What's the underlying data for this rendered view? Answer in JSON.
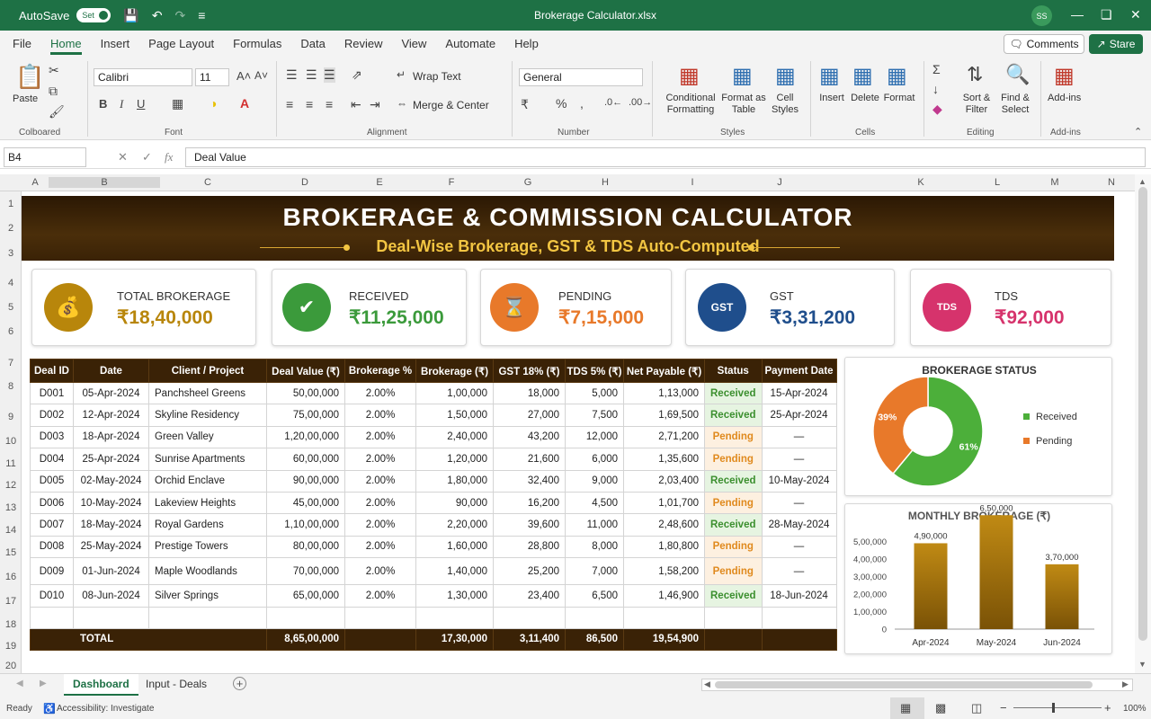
{
  "titlebar": {
    "autosave": "AutoSave",
    "toggle": "Set",
    "filename": "Brokerage Calculator.xlsx",
    "user_initials": "SS"
  },
  "menu": {
    "items": [
      "File",
      "Home",
      "Insert",
      "Page Layout",
      "Formulas",
      "Data",
      "Review",
      "View",
      "Automate",
      "Help"
    ],
    "comments": "Comments",
    "share": "Stare"
  },
  "ribbon": {
    "paste": "Paste",
    "font_name": "Calibri",
    "font_size": "11",
    "wrap_text": "Wrap Text",
    "merge_center": "Merge & Center",
    "number_format": "General",
    "conditional": "Conditional Formatting",
    "format_table": "Format as Table",
    "cell_styles": "Cell Styles",
    "insert": "Insert",
    "delete": "Delete",
    "format": "Format",
    "sort_filter": "Sort & Filter",
    "find_select": "Find & Select",
    "addins": "Add-ins",
    "groups": {
      "clipboard": "Colboared",
      "font": "Font",
      "alignment": "Alignment",
      "number": "Number",
      "styles": "Styles",
      "cells": "Cells",
      "editing": "Editing",
      "addins": "Add-ins"
    }
  },
  "formula_bar": {
    "name_box": "B4",
    "fx": "fx",
    "content": "Deal Value"
  },
  "columns": [
    "A",
    "B",
    "C",
    "D",
    "E",
    "F",
    "G",
    "H",
    "I",
    "J",
    "K",
    "L",
    "M",
    "N"
  ],
  "rows": [
    "1",
    "2",
    "3",
    "4",
    "5",
    "6",
    "7",
    "8",
    "9",
    "10",
    "11",
    "12",
    "13",
    "14",
    "15",
    "16",
    "17",
    "18",
    "19",
    "20"
  ],
  "banner": {
    "title": "BROKERAGE & COMMISSION CALCULATOR",
    "subtitle": "Deal-Wise Brokerage, GST & TDS Auto-Computed"
  },
  "kpis": [
    {
      "label": "TOTAL BROKERAGE",
      "value": "₹18,40,000",
      "color": "#b8860b",
      "icon": "money-hand-icon"
    },
    {
      "label": "RECEIVED",
      "value": "₹11,25,000",
      "color": "#3b9a3b",
      "icon": "handshake-icon"
    },
    {
      "label": "PENDING",
      "value": "₹7,15,000",
      "color": "#e8792a",
      "icon": "hourglass-icon"
    },
    {
      "label": "GST",
      "value": "₹3,31,200",
      "color": "#1f4e8c",
      "icon": "gst-icon"
    },
    {
      "label": "TDS",
      "value": "₹92,000",
      "color": "#d6336c",
      "icon": "tds-icon"
    }
  ],
  "table": {
    "headers": [
      "Deal ID",
      "Date",
      "Client / Project",
      "Deal Value (₹)",
      "Brokerage %",
      "Brokerage (₹)",
      "GST 18% (₹)",
      "TDS 5% (₹)",
      "Net Payable (₹)",
      "Status",
      "Payment Date"
    ],
    "rows": [
      [
        "D001",
        "05-Apr-2024",
        "Panchsheel Greens",
        "50,00,000",
        "2.00%",
        "1,00,000",
        "18,000",
        "5,000",
        "1,13,000",
        "Received",
        "15-Apr-2024"
      ],
      [
        "D002",
        "12-Apr-2024",
        "Skyline Residency",
        "75,00,000",
        "2.00%",
        "1,50,000",
        "27,000",
        "7,500",
        "1,69,500",
        "Received",
        "25-Apr-2024"
      ],
      [
        "D003",
        "18-Apr-2024",
        "Green Valley",
        "1,20,00,000",
        "2.00%",
        "2,40,000",
        "43,200",
        "12,000",
        "2,71,200",
        "Pending",
        "—"
      ],
      [
        "D004",
        "25-Apr-2024",
        "Sunrise Apartments",
        "60,00,000",
        "2.00%",
        "1,20,000",
        "21,600",
        "6,000",
        "1,35,600",
        "Pending",
        "—"
      ],
      [
        "D005",
        "02-May-2024",
        "Orchid Enclave",
        "90,00,000",
        "2.00%",
        "1,80,000",
        "32,400",
        "9,000",
        "2,03,400",
        "Received",
        "10-May-2024"
      ],
      [
        "D006",
        "10-May-2024",
        "Lakeview Heights",
        "45,00,000",
        "2.00%",
        "90,000",
        "16,200",
        "4,500",
        "1,01,700",
        "Pending",
        "—"
      ],
      [
        "D007",
        "18-May-2024",
        "Royal Gardens",
        "1,10,00,000",
        "2.00%",
        "2,20,000",
        "39,600",
        "11,000",
        "2,48,600",
        "Received",
        "28-May-2024"
      ],
      [
        "D008",
        "25-May-2024",
        "Prestige Towers",
        "80,00,000",
        "2.00%",
        "1,60,000",
        "28,800",
        "8,000",
        "1,80,800",
        "Pending",
        "—"
      ],
      [
        "D009",
        "01-Jun-2024",
        "Maple Woodlands",
        "70,00,000",
        "2.00%",
        "1,40,000",
        "25,200",
        "7,000",
        "1,58,200",
        "Pending",
        "—"
      ],
      [
        "D010",
        "08-Jun-2024",
        "Silver Springs",
        "65,00,000",
        "2.00%",
        "1,30,000",
        "23,400",
        "6,500",
        "1,46,900",
        "Received",
        "18-Jun-2024"
      ]
    ],
    "total": {
      "label": "TOTAL",
      "deal_value": "8,65,00,000",
      "brokerage": "17,30,000",
      "gst": "3,11,400",
      "tds": "86,500",
      "net": "19,54,900"
    }
  },
  "chart_data": [
    {
      "type": "pie",
      "title": "BROKERAGE STATUS",
      "categories": [
        "Received",
        "Pending"
      ],
      "values": [
        61,
        39
      ],
      "labels": [
        "61%",
        "39%"
      ],
      "colors": [
        "#4caf3a",
        "#e8792a"
      ],
      "legend": "right"
    },
    {
      "type": "bar",
      "title": "MONTHLY BROKERAGE (₹)",
      "categories": [
        "Apr-2024",
        "May-2024",
        "Jun-2024"
      ],
      "values": [
        490000,
        650000,
        370000
      ],
      "data_labels": [
        "4,90,000",
        "6,50,000",
        "3,70,000"
      ],
      "yticks": [
        "5,00,000",
        "4,00,000",
        "3,00,000",
        "2,00,000",
        "1,00,000",
        "0"
      ],
      "ylim": [
        0,
        650000
      ],
      "color": "#a5720a"
    }
  ],
  "sheets": {
    "tabs": [
      "Dashboard",
      "Input - Deals"
    ],
    "active": "Dashboard"
  },
  "status": {
    "ready": "Ready",
    "accessibility": "Accessibility: Investigate",
    "zoom": "100%"
  }
}
